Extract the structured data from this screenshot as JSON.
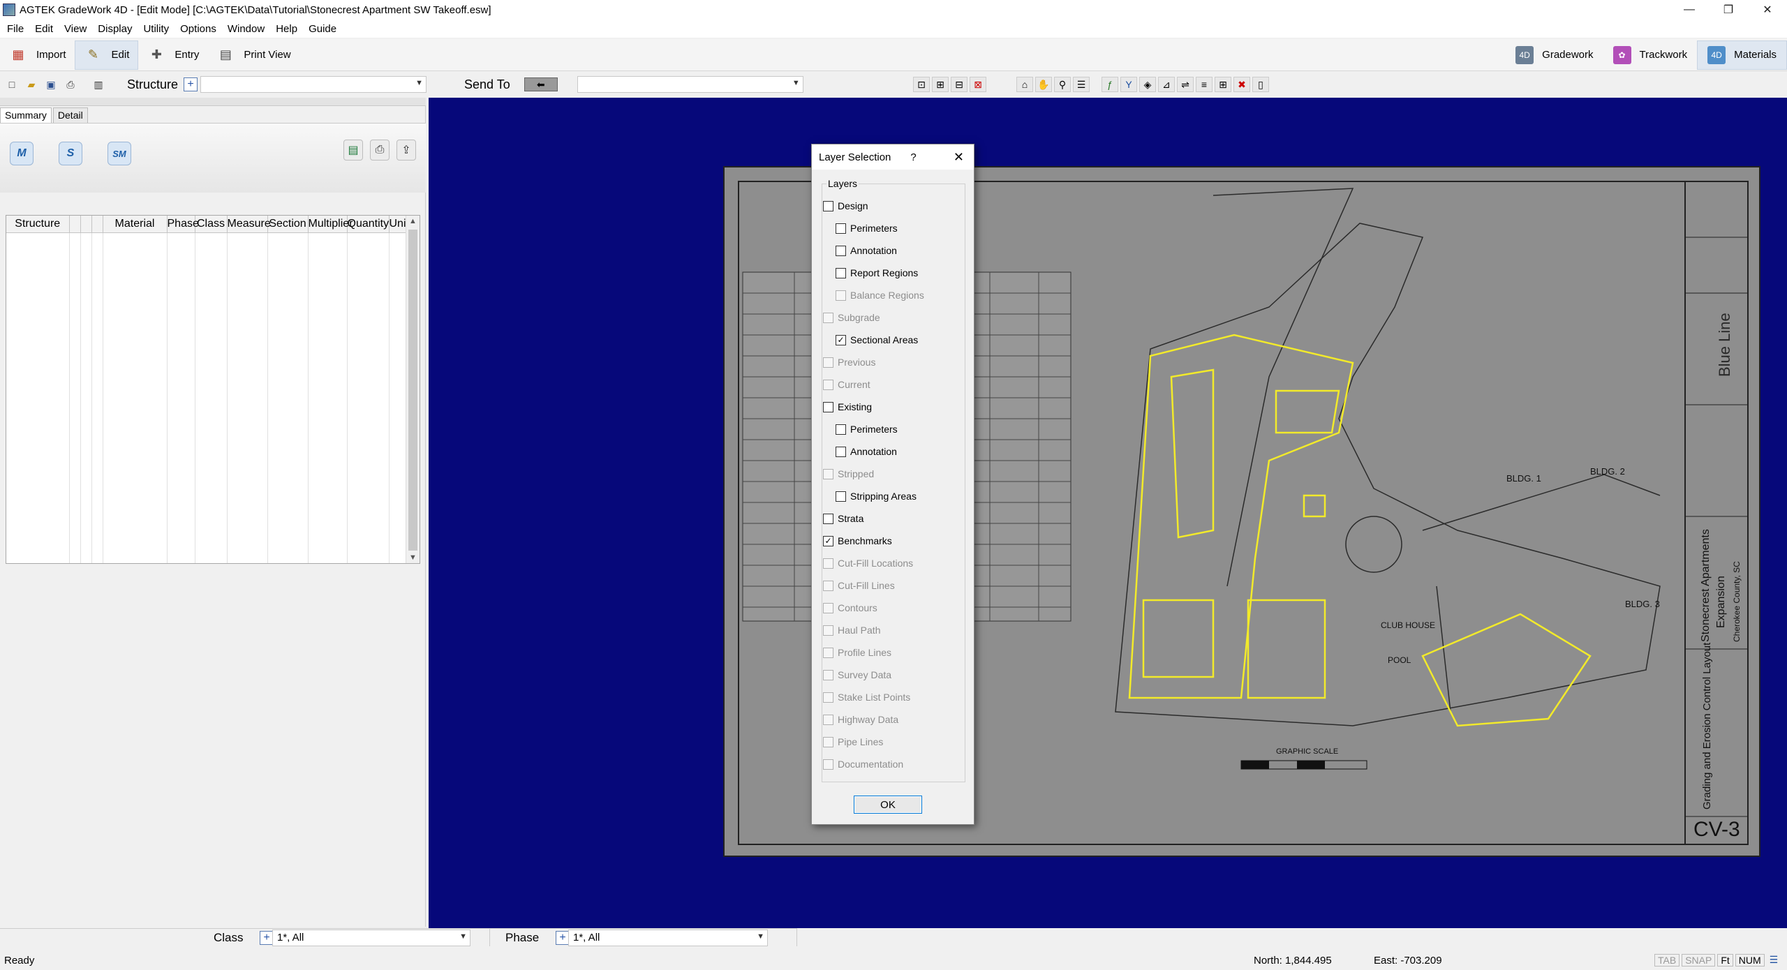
{
  "window": {
    "title": "AGTEK GradeWork 4D - [Edit Mode]  [C:\\AGTEK\\Data\\Tutorial\\Stonecrest Apartment SW Takeoff.esw]",
    "minimize": "—",
    "maximize": "❐",
    "close": "✕"
  },
  "menu": [
    "File",
    "Edit",
    "View",
    "Display",
    "Utility",
    "Options",
    "Window",
    "Help",
    "Guide"
  ],
  "modes": [
    {
      "label": "Import",
      "icon": "import-icon"
    },
    {
      "label": "Edit",
      "icon": "edit-icon",
      "active": true
    },
    {
      "label": "Entry",
      "icon": "entry-icon"
    },
    {
      "label": "Print View",
      "icon": "print-view-icon"
    }
  ],
  "apps": [
    {
      "label": "Gradework",
      "icon": "gradework-icon",
      "color": "#6b7f95"
    },
    {
      "label": "Trackwork",
      "icon": "trackwork-icon",
      "color": "#b24fb8"
    },
    {
      "label": "Materials",
      "icon": "materials-icon",
      "color": "#4f8ec9",
      "active": true
    }
  ],
  "toolbar2": {
    "structure_label": "Structure",
    "structure_value": "",
    "sendto_label": "Send To",
    "sendto_value": "",
    "plus": "+"
  },
  "tabs": [
    {
      "label": "Summary",
      "active": true
    },
    {
      "label": "Detail"
    }
  ],
  "summary_buttons": [
    "M",
    "S",
    "SM"
  ],
  "table": {
    "columns": [
      "Structure",
      "",
      "",
      "",
      "Material",
      "Phase",
      "Class",
      "Measure",
      "Section",
      "Multiplier",
      "Quantity",
      "Unit"
    ]
  },
  "filters": {
    "class_label": "Class",
    "class_value": "1*, All",
    "phase_label": "Phase",
    "phase_value": "1*, All"
  },
  "status": {
    "left": "Ready",
    "north": "North: 1,844.495",
    "east": "East: -703.209",
    "flags": [
      {
        "label": "TAB",
        "dim": true
      },
      {
        "label": "SNAP",
        "dim": true
      },
      {
        "label": "Ft",
        "dim": false
      },
      {
        "label": "NUM",
        "dim": false
      }
    ]
  },
  "dialog": {
    "title": "Layer Selection",
    "help": "?",
    "close": "✕",
    "group_label": "Layers",
    "ok_label": "OK",
    "layers": [
      {
        "label": "Design",
        "checked": false,
        "enabled": true,
        "indent": 0
      },
      {
        "label": "Perimeters",
        "checked": false,
        "enabled": true,
        "indent": 1
      },
      {
        "label": "Annotation",
        "checked": false,
        "enabled": true,
        "indent": 1
      },
      {
        "label": "Report Regions",
        "checked": false,
        "enabled": true,
        "indent": 1
      },
      {
        "label": "Balance Regions",
        "checked": false,
        "enabled": false,
        "indent": 1
      },
      {
        "label": "Subgrade",
        "checked": false,
        "enabled": false,
        "indent": 0
      },
      {
        "label": "Sectional Areas",
        "checked": true,
        "enabled": true,
        "indent": 1
      },
      {
        "label": "Previous",
        "checked": false,
        "enabled": false,
        "indent": 0
      },
      {
        "label": "Current",
        "checked": false,
        "enabled": false,
        "indent": 0
      },
      {
        "label": "Existing",
        "checked": false,
        "enabled": true,
        "indent": 0
      },
      {
        "label": "Perimeters",
        "checked": false,
        "enabled": true,
        "indent": 1
      },
      {
        "label": "Annotation",
        "checked": false,
        "enabled": true,
        "indent": 1
      },
      {
        "label": "Stripped",
        "checked": false,
        "enabled": false,
        "indent": 0
      },
      {
        "label": "Stripping Areas",
        "checked": false,
        "enabled": true,
        "indent": 1
      },
      {
        "label": "Strata",
        "checked": false,
        "enabled": true,
        "indent": 0
      },
      {
        "label": "Benchmarks",
        "checked": true,
        "enabled": true,
        "indent": 0
      },
      {
        "label": "Cut-Fill Locations",
        "checked": false,
        "enabled": false,
        "indent": 0
      },
      {
        "label": "Cut-Fill Lines",
        "checked": false,
        "enabled": false,
        "indent": 0
      },
      {
        "label": "Contours",
        "checked": false,
        "enabled": false,
        "indent": 0
      },
      {
        "label": "Haul Path",
        "checked": false,
        "enabled": false,
        "indent": 0
      },
      {
        "label": "Profile Lines",
        "checked": false,
        "enabled": false,
        "indent": 0
      },
      {
        "label": "Survey Data",
        "checked": false,
        "enabled": false,
        "indent": 0
      },
      {
        "label": "Stake List Points",
        "checked": false,
        "enabled": false,
        "indent": 0
      },
      {
        "label": "Highway Data",
        "checked": false,
        "enabled": false,
        "indent": 0
      },
      {
        "label": "Pipe Lines",
        "checked": false,
        "enabled": false,
        "indent": 0
      },
      {
        "label": "Documentation",
        "checked": false,
        "enabled": false,
        "indent": 0
      }
    ]
  },
  "drawing": {
    "title_block": [
      "Stonecrest Apartments",
      "Expansion",
      "Cherokee County, SC"
    ],
    "sheet_title": "Grading and Erosion Control Layout",
    "sheet_no": "CV-3",
    "labels": [
      "BLDG. 1",
      "BLDG. 2",
      "BLDG. 3",
      "CLUB HOUSE",
      "POOL",
      "GRAPHIC SCALE"
    ],
    "company": "Blue Line",
    "colors": {
      "canvas": "#06087a",
      "sheet": "#8e8e8e",
      "design": "#f2ea2a"
    }
  }
}
